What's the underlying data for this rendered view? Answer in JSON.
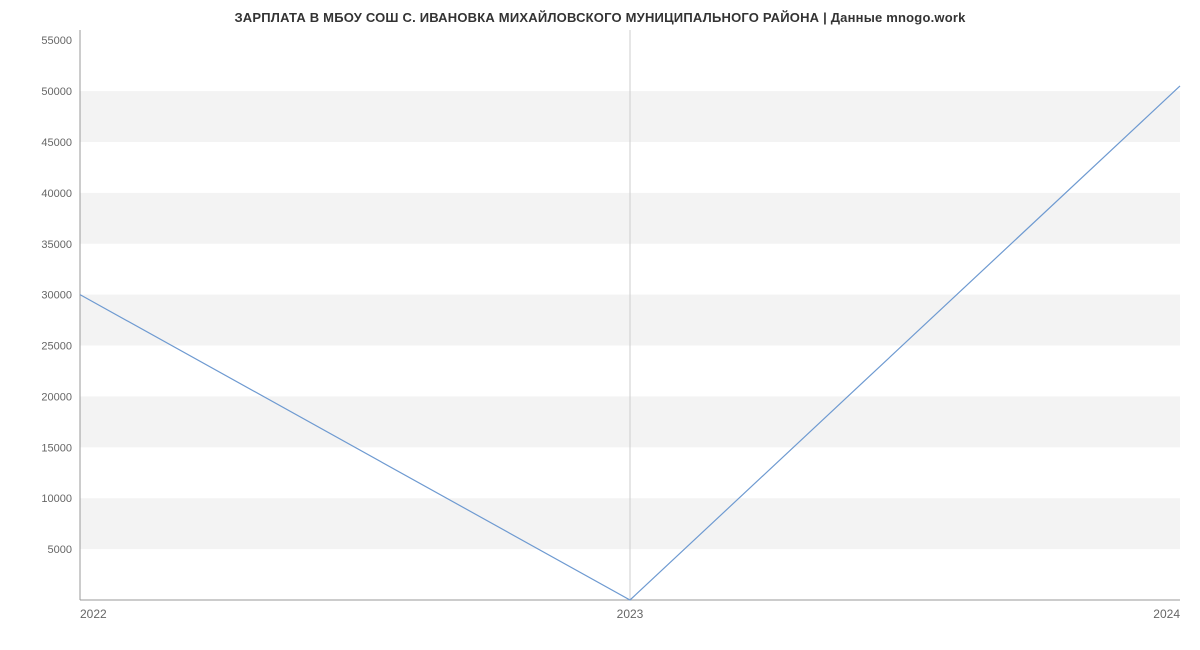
{
  "title": "ЗАРПЛАТА В МБОУ СОШ С. ИВАНОВКА МИХАЙЛОВСКОГО МУНИЦИПАЛЬНОГО РАЙОНА | Данные mnogo.work",
  "chart_data": {
    "type": "line",
    "x": [
      2022,
      2023,
      2024
    ],
    "values": [
      30000,
      0,
      50500
    ],
    "title": "ЗАРПЛАТА В МБОУ СОШ С. ИВАНОВКА МИХАЙЛОВСКОГО МУНИЦИПАЛЬНОГО РАЙОНА | Данные mnogo.work",
    "xlabel": "",
    "ylabel": "",
    "y_ticks": [
      5000,
      10000,
      15000,
      20000,
      25000,
      30000,
      35000,
      40000,
      45000,
      50000,
      55000
    ],
    "x_ticks": [
      2022,
      2023,
      2024
    ],
    "ylim": [
      0,
      56000
    ],
    "xlim": [
      2022,
      2024
    ],
    "line_color": "#6e9ad1"
  }
}
